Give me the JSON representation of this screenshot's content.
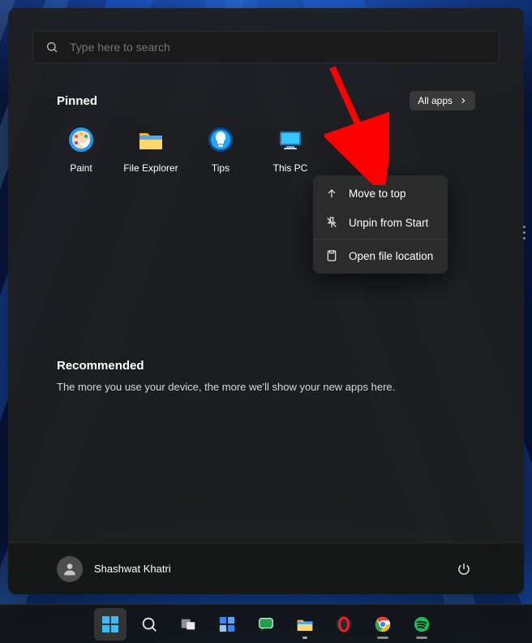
{
  "search": {
    "placeholder": "Type here to search"
  },
  "pinned": {
    "title": "Pinned",
    "all_apps_label": "All apps",
    "apps": [
      {
        "name": "Paint",
        "icon": "paint-icon"
      },
      {
        "name": "File Explorer",
        "icon": "file-explorer-icon"
      },
      {
        "name": "Tips",
        "icon": "tips-icon"
      },
      {
        "name": "This PC",
        "icon": "this-pc-icon"
      }
    ]
  },
  "context_menu": {
    "items": [
      {
        "label": "Move to top",
        "icon": "arrow-up-icon"
      },
      {
        "label": "Unpin from Start",
        "icon": "unpin-icon"
      },
      {
        "label": "Open file location",
        "icon": "file-location-icon"
      }
    ]
  },
  "recommended": {
    "title": "Recommended",
    "message": "The more you use your device, the more we'll show your new apps here."
  },
  "user": {
    "name": "Shashwat Khatri"
  },
  "taskbar": {
    "items": [
      {
        "name": "start",
        "icon": "windows-icon",
        "state": "selected"
      },
      {
        "name": "search",
        "icon": "search-icon"
      },
      {
        "name": "task-view",
        "icon": "taskview-icon"
      },
      {
        "name": "widgets",
        "icon": "widgets-icon"
      },
      {
        "name": "chat",
        "icon": "chat-icon"
      },
      {
        "name": "file-explorer",
        "icon": "file-explorer-icon",
        "state": "pinned"
      },
      {
        "name": "opera",
        "icon": "opera-icon"
      },
      {
        "name": "chrome",
        "icon": "chrome-icon",
        "state": "open"
      },
      {
        "name": "spotify",
        "icon": "spotify-icon",
        "state": "open"
      }
    ]
  },
  "colors": {
    "accent_red": "#ff0000"
  }
}
